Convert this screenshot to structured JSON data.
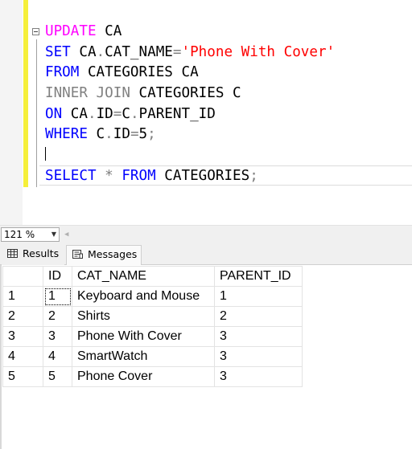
{
  "editor": {
    "lines": [
      {
        "k1": "UPDATE",
        "t1": " CA"
      },
      {
        "k1": "SET",
        "t1": " CA",
        "d1": ".",
        "t2": "CAT_NAME",
        "op": "=",
        "s1": "'Phone With Cover'"
      },
      {
        "k1": "FROM",
        "t1": " CATEGORIES CA"
      },
      {
        "k1": "INNER JOIN",
        "t1": " CATEGORIES C"
      },
      {
        "k1": "ON",
        "t1": " CA",
        "d1": ".",
        "t2": "ID",
        "op": "=",
        "t3": "C",
        "d2": ".",
        "t4": "PARENT_ID"
      },
      {
        "k1": "WHERE",
        "t1": " C",
        "d1": ".",
        "t2": "ID",
        "op": "=",
        "t3": "5",
        "semi": ";"
      },
      {
        "k1": "SELECT",
        "op1": " * ",
        "k2": "FROM",
        "t1": " CATEGORIES",
        "semi": ";"
      }
    ]
  },
  "status": {
    "zoom": "121 %"
  },
  "tabs": {
    "results": "Results",
    "messages": "Messages"
  },
  "grid": {
    "columns": [
      "ID",
      "CAT_NAME",
      "PARENT_ID"
    ],
    "rows": [
      {
        "n": "1",
        "id": "1",
        "name": "Keyboard and Mouse",
        "pid": "1"
      },
      {
        "n": "2",
        "id": "2",
        "name": "Shirts",
        "pid": "2"
      },
      {
        "n": "3",
        "id": "3",
        "name": "Phone With Cover",
        "pid": "3"
      },
      {
        "n": "4",
        "id": "4",
        "name": "SmartWatch",
        "pid": "3"
      },
      {
        "n": "5",
        "id": "5",
        "name": "Phone Cover",
        "pid": "3"
      }
    ]
  },
  "colors": {
    "keyword": "#0000ff",
    "string": "#ff0000",
    "update_keyword": "#ff00ff",
    "change_bar": "#f5ef3a"
  }
}
